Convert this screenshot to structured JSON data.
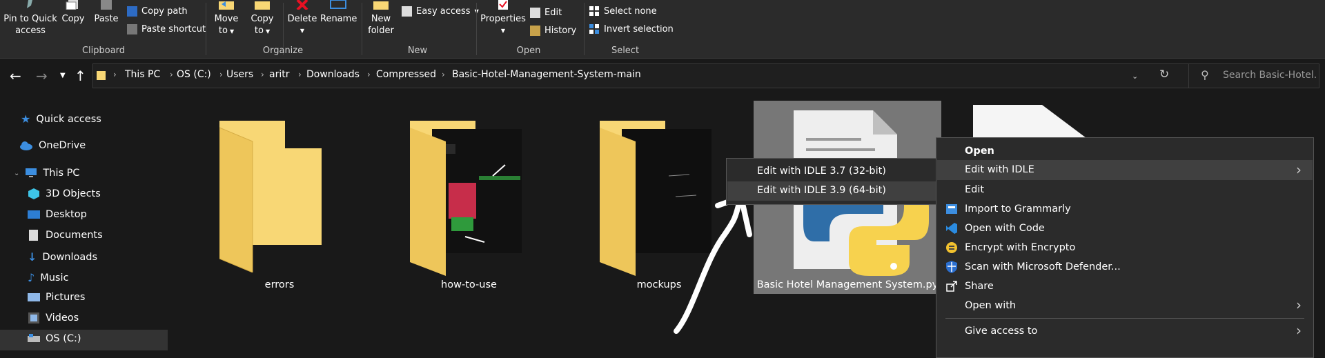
{
  "ribbon": {
    "clipboard": {
      "pin_quick_access_line1": "Pin to Quick",
      "pin_quick_access_line2": "access",
      "copy": "Copy",
      "paste": "Paste",
      "copy_path": "Copy path",
      "paste_shortcut": "Paste shortcut",
      "group_label": "Clipboard"
    },
    "organize": {
      "move_to_line1": "Move",
      "move_to_line2": "to",
      "copy_to_line1": "Copy",
      "copy_to_line2": "to",
      "delete": "Delete",
      "rename": "Rename",
      "group_label": "Organize"
    },
    "new": {
      "new_folder_line1": "New",
      "new_folder_line2": "folder",
      "easy_access": "Easy access",
      "group_label": "New"
    },
    "open": {
      "properties": "Properties",
      "edit": "Edit",
      "history": "History",
      "group_label": "Open"
    },
    "select": {
      "select_none": "Select none",
      "invert_selection": "Invert selection",
      "group_label": "Select"
    }
  },
  "address": {
    "crumbs": [
      "This PC",
      "OS (C:)",
      "Users",
      "aritr",
      "Downloads",
      "Compressed",
      "Basic-Hotel-Management-System-main"
    ],
    "search_placeholder": "Search Basic-Hotel..."
  },
  "nav_pane": {
    "quick_access": "Quick access",
    "onedrive": "OneDrive",
    "this_pc": "This PC",
    "items": [
      "3D Objects",
      "Desktop",
      "Documents",
      "Downloads",
      "Music",
      "Pictures",
      "Videos",
      "OS (C:)"
    ]
  },
  "content": {
    "items": [
      "errors",
      "how-to-use",
      "mockups",
      "Basic Hotel Management System.py"
    ]
  },
  "context_menu": {
    "items": [
      "Open",
      "Edit with IDLE",
      "Edit",
      "Import to Grammarly",
      "Open with Code",
      "Encrypt with Encrypto",
      "Scan with Microsoft Defender...",
      "Share",
      "Open with",
      "Give access to"
    ],
    "submenu": [
      "Edit with IDLE 3.7 (32-bit)",
      "Edit with IDLE 3.9 (64-bit)"
    ]
  },
  "colors": {
    "accent_blue": "#3c8ee0",
    "folder_yellow": "#f8d775",
    "menu_bg": "#2b2b2b",
    "window_bg": "#191919"
  }
}
